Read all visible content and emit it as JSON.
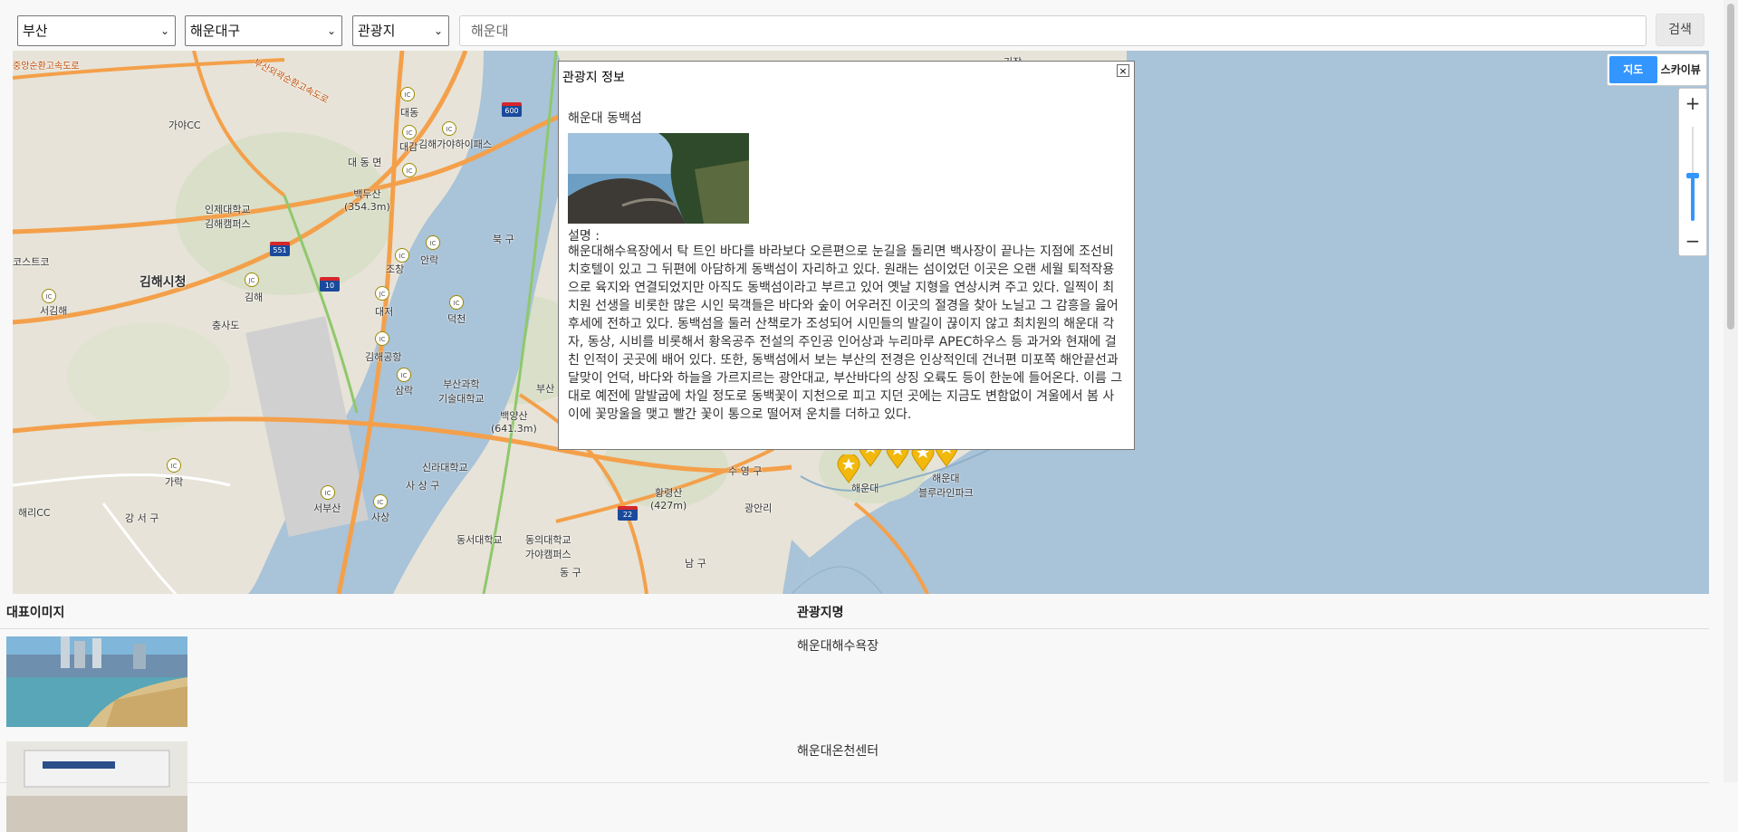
{
  "search": {
    "region": "부산",
    "district": "해운대구",
    "category": "관광지",
    "query": "해운대",
    "button": "검색"
  },
  "map": {
    "type_map": "지도",
    "type_skyview": "스카이뷰",
    "zoom_in": "+",
    "zoom_out": "−",
    "scale": "2km",
    "brand": "kakao",
    "labels": {
      "road_top": "중앙순환고속도로",
      "road_top2": "부산외곽순환고속도로",
      "gaya_cc": "가야CC",
      "daedong": "대 동 면",
      "baekdusan": "백두산\n(354.3m)",
      "inje": "인제대학교\n김해캠퍼스",
      "costco": "코스트코",
      "gimhae_city": "김해시청",
      "gimhae": "김해",
      "seogimhae": "서김해",
      "chusado": "충사도",
      "bukgu": "북 구",
      "daedong_ic": "대동",
      "daegam": "대감",
      "gimhae_gaya": "김해가야하이패스",
      "gimhae_airport": "김해공항",
      "busan_sci": "부산과학\n기술대학교",
      "baegyangsan": "백양산\n(641.3m)",
      "silla": "신라대학교",
      "sasanggu": "사 상 구",
      "sasang": "사상",
      "seobusan": "서부산",
      "gangseogu": "강 서 구",
      "haeri_cc": "해리CC",
      "gara": "가락",
      "dongseo": "동서대학교",
      "dongeui": "동의대학교\n가야캠퍼스",
      "donggu": "동 구",
      "namgu": "남 구",
      "suyeonggu": "수 영 구",
      "gwangalli": "광안리",
      "hwangryeongsan": "황령산\n(427m)",
      "haeundae": "해운대",
      "blueline": "해운대\n블루라인파크",
      "anak": "안락",
      "daejeo": "대저",
      "deokcheon": "덕천",
      "sangrak": "삼락",
      "jochang": "조창",
      "busan_gu": "부산",
      "sseo": "기장"
    }
  },
  "info_window": {
    "title": "관광지 정보",
    "close": "×",
    "name": "해운대 동백섬",
    "desc_label": "설명 :",
    "description": "해운대해수욕장에서 탁 트인 바다를 바라보다 오른편으로 눈길을 돌리면 백사장이 끝나는 지점에 조선비치호텔이 있고 그 뒤편에 아담하게 동백섬이 자리하고 있다. 원래는 섬이었던 이곳은 오랜 세월 퇴적작용으로 육지와 연결되었지만 아직도 동백섬이라고 부르고 있어 옛날 지형을 연상시켜 주고 있다. 일찍이 최치원 선생을 비롯한 많은 시인 묵객들은 바다와 숲이 어우러진 이곳의 절경을 찾아 노닐고 그 감흥을 읊어 후세에 전하고 있다. 동백섬을 둘러 산책로가 조성되어 시민들의 발길이 끊이지 않고 최치원의 해운대 각자, 동상, 시비를 비롯해서 황옥공주 전설의 주인공 인어상과 누리마루 APEC하우스 등 과거와 현재에 걸친 인적이 곳곳에 배어 있다. 또한, 동백섬에서 보는 부산의 전경은 인상적인데 건너편 미포쪽 해안끝선과 달맞이 언덕, 바다와 하늘을 가르지르는 광안대교, 부산바다의 상징 오륙도 등이 한눈에 들어온다. 이름 그대로 예전에 말발굽에 차일 정도로 동백꽃이 지천으로 피고 지던 곳에는 지금도 변함없이 겨울에서 봄 사이에 꽃망울을 맺고 빨간 꽃이 통으로 떨어져 운치를 더하고 있다."
  },
  "table": {
    "col_image": "대표이미지",
    "col_name": "관광지명",
    "rows": [
      {
        "name": "해운대해수욕장"
      },
      {
        "name": "해운대온천센터"
      }
    ]
  }
}
